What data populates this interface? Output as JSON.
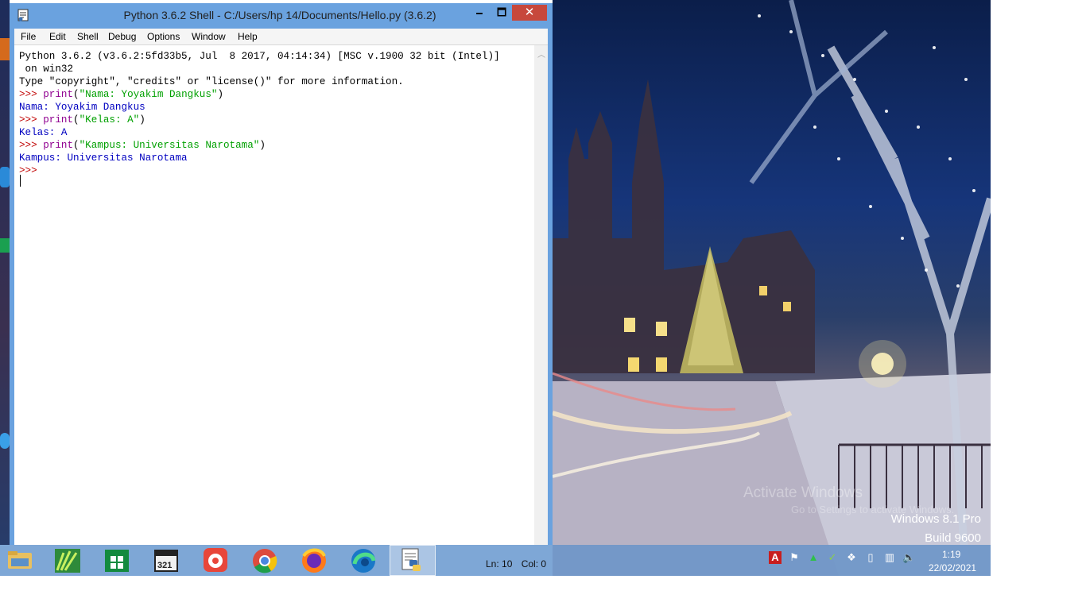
{
  "window": {
    "title": "Python 3.6.2 Shell - C:/Users/hp 14/Documents/Hello.py (3.6.2)",
    "controls": {
      "minimize": "🗕",
      "maximize": "🗖",
      "close": "✕"
    }
  },
  "menubar": [
    "File",
    "Edit",
    "Shell",
    "Debug",
    "Options",
    "Window",
    "Help"
  ],
  "shell": {
    "banner_1": "Python 3.6.2 (v3.6.2:5fd33b5, Jul  8 2017, 04:14:34) [MSC v.1900 32 bit (Intel)]",
    "banner_2": " on win32",
    "banner_3": "Type \"copyright\", \"credits\" or \"license()\" for more information.",
    "prompt": ">>>",
    "cmd1_kw": "print",
    "cmd1_str": "\"Nama: Yoyakim Dangkus\"",
    "out1": "Nama: Yoyakim Dangkus",
    "cmd2_kw": "print",
    "cmd2_str": "\"Kelas: A\"",
    "out2": "Kelas: A",
    "cmd3_kw": "print",
    "cmd3_str": "\"Kampus: Universitas Narotama\"",
    "out3": "Kampus: Universitas Narotama"
  },
  "statusbar": {
    "line": "Ln: 10",
    "col": "Col: 0"
  },
  "desktop": {
    "watermark_line1": "Activate Windows",
    "watermark_line2": "Go to Settings to activate Windows.",
    "os_name": "Windows 8.1 Pro",
    "os_build": "Build 9600"
  },
  "taskbar": {
    "apps": [
      "file-explorer-icon",
      "cute-app-icon",
      "store-icon",
      "media-player-321-icon",
      "screen-recorder-icon",
      "chrome-icon",
      "firefox-icon",
      "edge-icon",
      "python-idle-icon"
    ],
    "clock_time": "1:19",
    "clock_date": "22/02/2021"
  },
  "colors": {
    "titlebar": "#6aa2df",
    "close_button": "#c7483c",
    "prompt": "#c00000",
    "keyword": "#900090",
    "string": "#00a000",
    "output": "#0000c0"
  }
}
